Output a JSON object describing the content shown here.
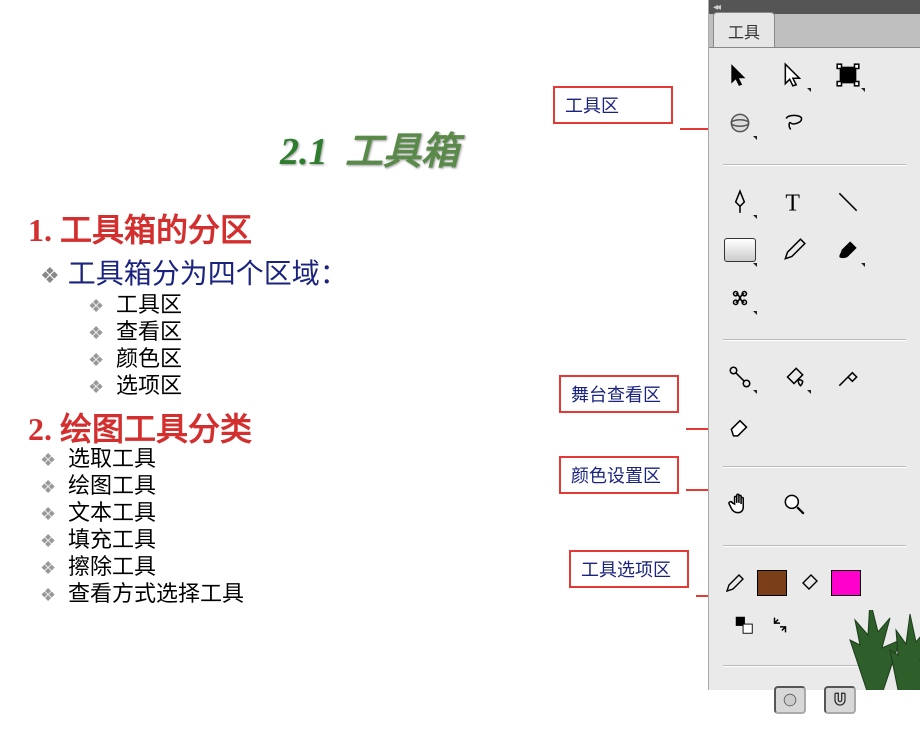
{
  "title": {
    "number": "2.1",
    "text": "工具箱"
  },
  "section1": {
    "number": "1.",
    "text": "工具箱的分区"
  },
  "subline": "工具箱分为四个区域：",
  "areas": [
    "工具区",
    "查看区",
    "颜色区",
    "选项区"
  ],
  "section2": {
    "number": "2.",
    "text": "绘图工具分类"
  },
  "categories": [
    "选取工具",
    "绘图工具",
    "文本工具",
    "填充工具",
    "擦除工具",
    "查看方式选择工具"
  ],
  "callouts": {
    "tools": "工具区",
    "view": "舞台查看区",
    "color": "颜色设置区",
    "options": "工具选项区"
  },
  "panel": {
    "tab": "工具",
    "colors": {
      "stroke": "#7A3E18",
      "fill": "#FF00CC"
    },
    "tool_names": [
      "selection",
      "subselection",
      "free-transform",
      "3d-rotate",
      "lasso",
      "pen",
      "text",
      "line",
      "rectangle",
      "pencil",
      "brush",
      "deco",
      "bone",
      "paint-bucket",
      "eyedropper",
      "eraser",
      "hand",
      "zoom"
    ],
    "option_names": [
      "smooth",
      "magnet"
    ]
  }
}
